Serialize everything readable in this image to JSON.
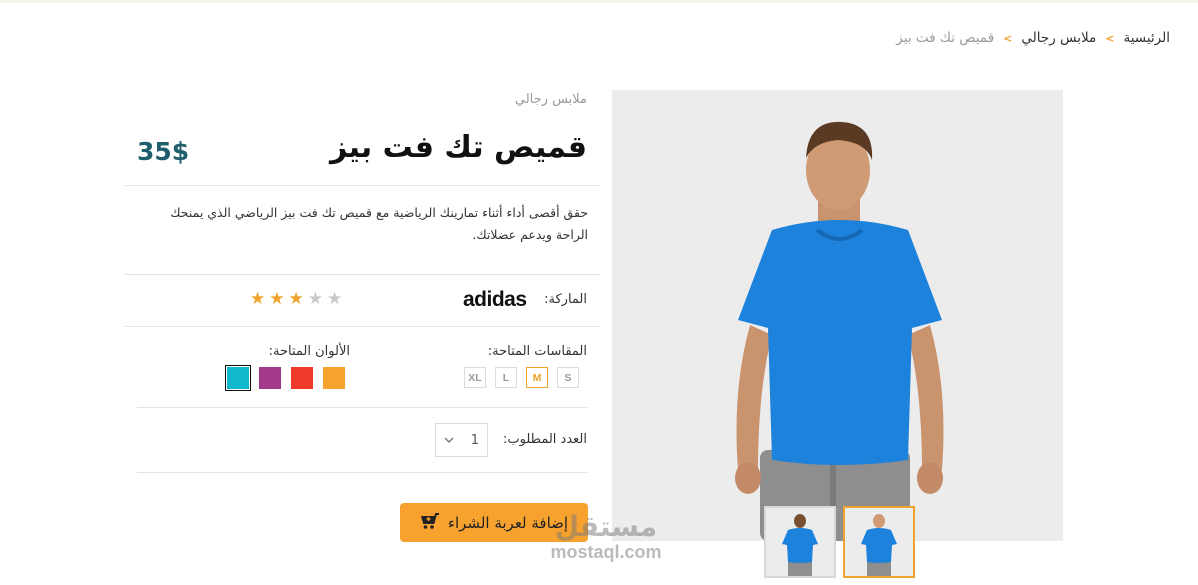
{
  "breadcrumb": {
    "home": "الرئيسية",
    "category": "ملابس رجالي",
    "current": "قميص تك فت بيز",
    "separator": ">"
  },
  "product": {
    "category": "ملابس رجالي",
    "title": "قميص تك فت بيز",
    "price": "35$",
    "description": "حقق أقصى أداء أثناء تمارينك الرياضية مع قميص تك فت بيز الرياضي الذي يمنحك الراحة ويدعم عضلاتك.",
    "brand_label": "الماركة:",
    "brand_name": "adidas",
    "rating": 3,
    "rating_max": 5,
    "sizes_label": "المقاسات المتاحة:",
    "sizes": [
      "S",
      "M",
      "L",
      "XL"
    ],
    "selected_size": "M",
    "colors_label": "الألوان المتاحة:",
    "colors": [
      "#f7a22f",
      "#f23a2c",
      "#a4388a",
      "#12b8cc"
    ],
    "selected_color": "#12b8cc",
    "quantity_label": "العدد المطلوب:",
    "quantity": "1",
    "add_to_cart": "إضافة لعربة الشراء"
  },
  "theme": {
    "accent": "#f7a22f",
    "price_color": "#1f5f6b",
    "shirt": "#1d82db"
  },
  "icons": {
    "cart": "cart-icon",
    "dropdown": "chevron-down-icon",
    "star": "star-icon"
  },
  "watermark": {
    "arabic": "مستقل",
    "latin": "mostaql.com"
  }
}
